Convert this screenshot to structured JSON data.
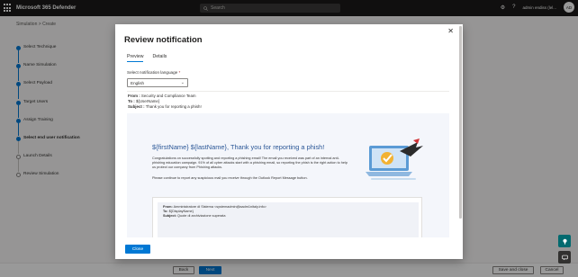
{
  "app": {
    "title": "Microsoft 365 Defender",
    "search_placeholder": "Search",
    "user_name": "admin endiss (lel...",
    "user_initials": "AD",
    "settings_icon": "gear-icon",
    "help_label": "?"
  },
  "breadcrumb": {
    "parent": "Simulation",
    "separator": ">",
    "current": "Create"
  },
  "steps": [
    {
      "label": "Select Technique",
      "status": "done"
    },
    {
      "label": "Name Simulation",
      "status": "done"
    },
    {
      "label": "Select Payload",
      "status": "done"
    },
    {
      "label": "Target Users",
      "status": "done"
    },
    {
      "label": "Assign Training",
      "status": "done"
    },
    {
      "label": "Select end user notification",
      "status": "current"
    },
    {
      "label": "Launch Details",
      "status": "todo"
    },
    {
      "label": "Review Simulation",
      "status": "todo"
    }
  ],
  "footer": {
    "back_label": "Back",
    "next_label": "Next",
    "save_close_label": "Save and close",
    "cancel_label": "Cancel"
  },
  "modal": {
    "title": "Review notification",
    "close_glyph": "✕",
    "tabs": [
      {
        "label": "Preview",
        "active": true
      },
      {
        "label": "Details",
        "active": false
      }
    ],
    "language_label": "Select notification language",
    "language_required": "*",
    "language_value": "English",
    "from_label": "From :",
    "from_value": "Security and Compliance Team",
    "to_label": "To :",
    "to_value": "${UserName}",
    "subject_label": "Subject :",
    "subject_value": "Thank you for reporting a phish!",
    "preview": {
      "heading": "${firstName} ${lastName}, Thank you for reporting a phish!",
      "body1": "Congratulations on successfully spotting and reporting a phishing email! The email you received was part of an internal anti-phishing education campaign. 91% of all cyber attacks start with a phishing email, so reporting the phish is the right action to help us protect our company from Phishing attacks.",
      "body2": "Please continue to report any suspicious mail you receive through the Outlook Report Message button.",
      "meta_from_label": "From:",
      "meta_from_value": "Amministratore di Sistema <systemadmin@aadm1nitaly.info>",
      "meta_to_label": "To:",
      "meta_to_value": "${DisplayName}",
      "meta_subject_label": "Subject:",
      "meta_subject_value": "Quote di archiviazione superata"
    },
    "close_label": "Close"
  },
  "colors": {
    "accent": "#0078d4",
    "topbar": "#1b1a19",
    "heading_blue": "#2b5797",
    "fab_teal": "#026a6f"
  }
}
